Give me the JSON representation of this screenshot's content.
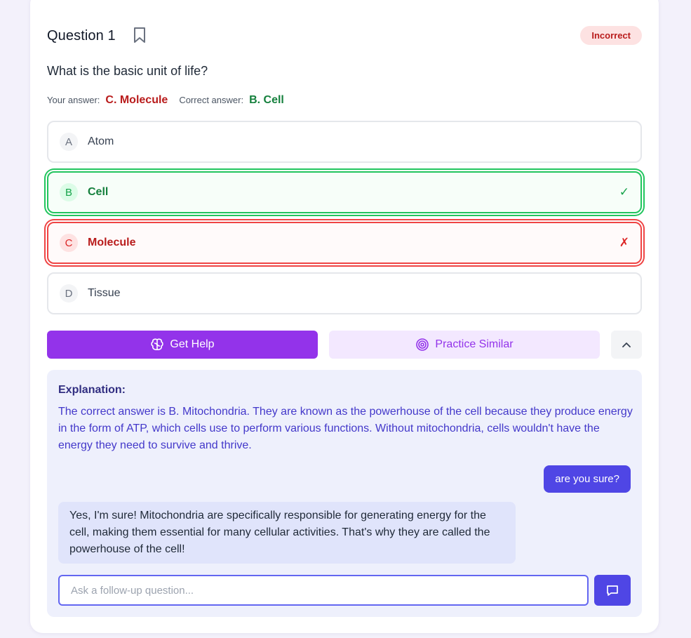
{
  "question": {
    "title": "Question 1",
    "status_badge": "Incorrect",
    "text": "What is the basic unit of life?",
    "your_answer_label": "Your answer:",
    "your_answer_value": "C. Molecule",
    "correct_answer_label": "Correct answer:",
    "correct_answer_value": "B. Cell"
  },
  "options": [
    {
      "letter": "A",
      "label": "Atom",
      "state": "neutral"
    },
    {
      "letter": "B",
      "label": "Cell",
      "state": "correct",
      "mark": "✓"
    },
    {
      "letter": "C",
      "label": "Molecule",
      "state": "wrong",
      "mark": "✗"
    },
    {
      "letter": "D",
      "label": "Tissue",
      "state": "neutral"
    }
  ],
  "actions": {
    "get_help_label": "Get Help",
    "practice_label": "Practice Similar"
  },
  "explanation": {
    "title": "Explanation:",
    "body": "The correct answer is B. Mitochondria. They are known as the powerhouse of the cell because they produce energy in the form of ATP, which cells use to perform various functions. Without mitochondria, cells wouldn't have the energy they need to survive and thrive."
  },
  "chat": {
    "user_message": "are you sure?",
    "bot_message": "Yes, I'm sure! Mitochondria are specifically responsible for generating energy for the cell, making them essential for many cellular activities. That's why they are called the powerhouse of the cell!",
    "input_placeholder": "Ask a follow-up question...",
    "input_value": ""
  },
  "icons": {
    "bookmark": "bookmark-icon",
    "help": "brain-icon",
    "practice": "target-icon",
    "collapse": "chevron-up-icon",
    "send": "message-icon"
  },
  "colors": {
    "primary_purple": "#9333ea",
    "indigo": "#4f46e5",
    "correct_green": "#22c55e",
    "wrong_red": "#ef4444",
    "badge_bg": "#fde2e2"
  }
}
